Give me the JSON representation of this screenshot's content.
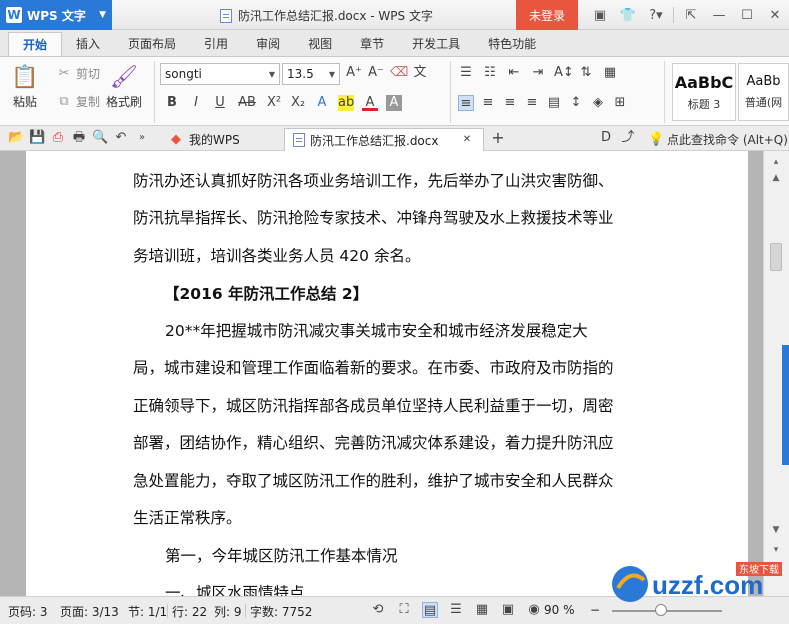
{
  "titlebar": {
    "app_menu": "WPS 文字",
    "doc_title": "防汛工作总结汇报.docx - WPS 文字",
    "login": "未登录",
    "extra_icons": [
      "skin-icon",
      "shirt-icon",
      "help-icon"
    ]
  },
  "ribbon_tabs": [
    "开始",
    "插入",
    "页面布局",
    "引用",
    "审阅",
    "视图",
    "章节",
    "开发工具",
    "特色功能"
  ],
  "ribbon": {
    "paste": "粘贴",
    "cut": "剪切",
    "copy": "复制",
    "format_painter": "格式刷",
    "font_name": "songti",
    "font_size": "13.5",
    "style1_sample": "AaBbC",
    "style1_label": "标题 3",
    "style2_sample": "AaBb",
    "style2_label": "普通(网"
  },
  "doc_tabs": {
    "home": "我的WPS",
    "current": "防汛工作总结汇报.docx",
    "search_cmd": "点此查找命令 (Alt+Q)"
  },
  "document": {
    "lines": [
      "防汛办还认真抓好防汛各项业务培训工作，先后举办了山洪灾害防御、",
      "防汛抗旱指挥长、防汛抢险专家技术、冲锋舟驾驶及水上救援技术等业",
      "务培训班，培训各类业务人员 420 余名。",
      "【2016 年防汛工作总结 2】",
      "20**年把握城市防汛减灾事关城市安全和城市经济发展稳定大",
      "局，城市建设和管理工作面临着新的要求。在市委、市政府及市防指的",
      "正确领导下，城区防汛指挥部各成员单位坚持人民利益重于一切，周密",
      "部署，团结协作，精心组织、完善防汛减灾体系建设，着力提升防汛应",
      "急处置能力，夺取了城区防汛工作的胜利，维护了城市安全和人民群众",
      "生活正常秩序。",
      "第一，今年城区防汛工作基本情况",
      "一、城区水雨情特点"
    ]
  },
  "statusbar": {
    "page_code": "页码: 3",
    "page": "页面: 3/13",
    "section": "节: 1/1",
    "row": "行: 22",
    "col": "列: 9",
    "word_count": "字数: 7752",
    "zoom": "90 %"
  },
  "watermark": {
    "brand": "uzzf.com",
    "sub": "东坡下载"
  },
  "colors": {
    "accent": "#2b79d6",
    "login": "#e8563f",
    "active_tab_text": "#1a62c2"
  }
}
